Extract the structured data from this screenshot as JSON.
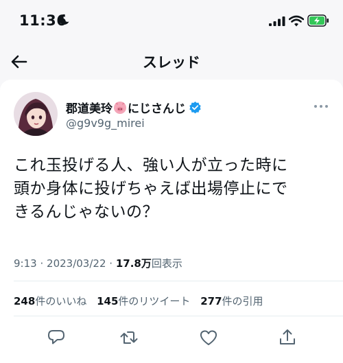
{
  "status_bar": {
    "time": "11:36"
  },
  "nav": {
    "title": "スレッド"
  },
  "tweet": {
    "display_name_prefix": "郡道美玲",
    "display_name_suffix": "にじさんじ",
    "handle": "@g9v9g_mirei",
    "text_lines": [
      "これ玉投げる人、強い人が立った時に",
      "頭か身体に投げちゃえば出場停止にで",
      "きるんじゃないの？"
    ],
    "time": "9:13",
    "separator": "·",
    "date": "2023/03/22",
    "views_count": "17.8万",
    "views_label": "回表示",
    "stats": {
      "likes_count": "248",
      "likes_label": "件のいいね",
      "retweets_count": "145",
      "retweets_label": "件のリツイート",
      "quotes_count": "277",
      "quotes_label": "件の引用"
    }
  },
  "icons": {
    "moon": "moon-icon",
    "signal": "cellular-signal-icon",
    "wifi": "wifi-icon",
    "battery": "battery-charging-icon",
    "back": "back-arrow-icon",
    "verified": "verified-badge-icon",
    "pig": "pig-emoji-icon",
    "more": "more-dots-icon",
    "reply": "reply-icon",
    "retweet": "retweet-icon",
    "like": "heart-icon",
    "share": "share-icon"
  },
  "colors": {
    "verified": "#1d9bf0",
    "battery": "#34c759",
    "pig": "#f4a7b9",
    "muted_text": "#536471"
  }
}
